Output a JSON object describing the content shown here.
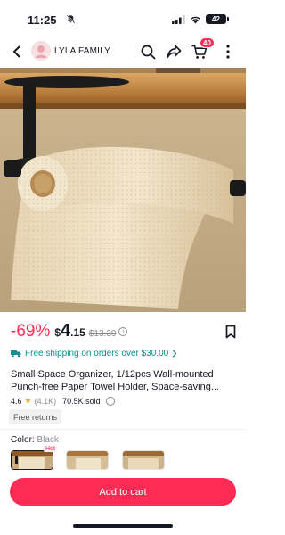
{
  "status_bar": {
    "time": "11:25",
    "battery": "42"
  },
  "nav": {
    "shop_name": "LYLA FAMILY",
    "cart_badge": "40"
  },
  "product": {
    "carousel_dots": 7,
    "carousel_active_index": 5,
    "discount": "-69%",
    "price_currency": "$",
    "price_whole": "4",
    "price_fraction": ".15",
    "original_price": "$13.39",
    "shipping_text": "Free shipping on orders over $30.00",
    "title": "Small Space Organizer, 1/12pcs Wall-mounted Punch-free Paper Towel Holder, Space-saving...",
    "rating": "4.6",
    "rating_count": "(4.1K)",
    "sold": "70.5K sold",
    "free_returns": "Free returns"
  },
  "variants": {
    "color_label": "Color:",
    "color_value": "Black",
    "hot_label": "Hot"
  },
  "actions": {
    "add_to_cart": "Add to cart"
  },
  "colors": {
    "accent": "#fe2c55",
    "shipping": "#0a8f8f",
    "text": "#161823",
    "muted": "#8a8b91"
  }
}
